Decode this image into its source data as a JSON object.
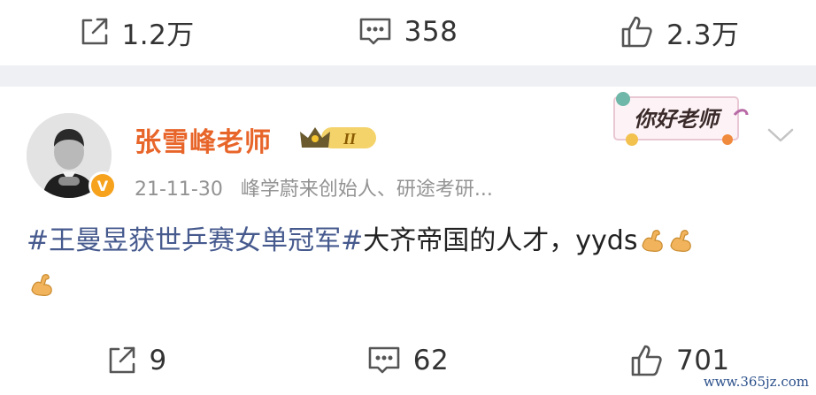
{
  "top_actions": {
    "repost_count": "1.2万",
    "comment_count": "358",
    "like_count": "2.3万"
  },
  "post": {
    "author": "张雪峰老师",
    "crown_level": "II",
    "verified_badge": "V",
    "date": "21-11-30",
    "source": "峰学蔚来创始人、研途考研...",
    "sticker_text": "你好老师",
    "content": {
      "topic": "#王曼昱获世乒赛女单冠军#",
      "text": "大齐帝国的人才，yyds",
      "emoji": "flexed-biceps-icon"
    },
    "actions": {
      "repost_count": "9",
      "comment_count": "62",
      "like_count": "701"
    }
  },
  "watermark": "www.365jz.com",
  "colors": {
    "username": "#e8652a",
    "topic": "#465a8e",
    "meta": "#939393",
    "divider": "#eef0f3",
    "verified": "#f6a21d"
  }
}
